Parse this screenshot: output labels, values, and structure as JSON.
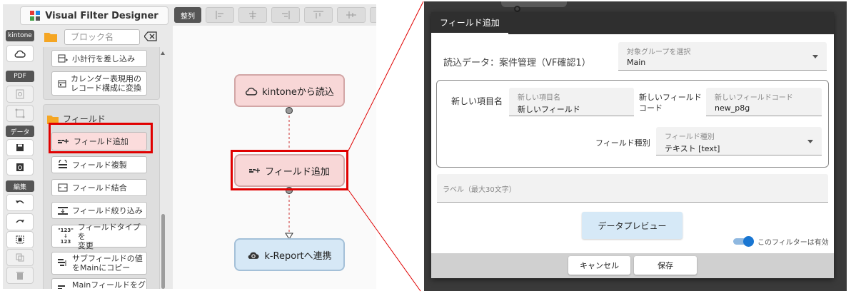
{
  "app": {
    "title": "Visual Filter Designer"
  },
  "toolbar": {
    "align_label": "整列"
  },
  "sidebar": {
    "kintone_label": "kintone",
    "pdf_label": "PDF",
    "data_label": "データ",
    "edit_label": "編集"
  },
  "palette": {
    "search_placeholder": "ブロック名",
    "items_top": [
      {
        "label": "小計行を差し込み",
        "icon": "table-row-insert-icon"
      },
      {
        "label": "カレンダー表現用の\nレコード構成に変換",
        "icon": "calendar-icon"
      }
    ],
    "field_folder": "フィールド",
    "field_items": [
      {
        "label": "フィールド追加",
        "icon": "field-add-icon"
      },
      {
        "label": "フィールド複製",
        "icon": "field-copy-icon"
      },
      {
        "label": "フィールド結合",
        "icon": "field-merge-icon"
      },
      {
        "label": "フィールド絞り込み",
        "icon": "field-filter-icon"
      },
      {
        "label": "フィールドタイプを\n変更",
        "icon": "field-type-icon"
      },
      {
        "label": "サブフィールドの値\nをMainにコピー",
        "icon": "subfield-copy-icon"
      },
      {
        "label": "Mainフィールドをグ\nループに変換",
        "icon": "group-convert-icon"
      }
    ],
    "type_icon_text_1": "\"123\"",
    "type_icon_text_2": "123"
  },
  "flow": {
    "node1": "kintoneから読込",
    "node2": "フィールド追加",
    "node3": "k-Reportへ連携"
  },
  "dialog": {
    "tab": "フィールド追加",
    "read_data": "読込データ：案件管理（VF確認1）",
    "target_group_label": "対象グループを選択",
    "target_group_value": "Main",
    "new_item_label": "新しい項目名",
    "new_item_field_label": "新しい項目名",
    "new_item_value": "新しいフィールド",
    "new_code_label": "新しいフィールド\nコード",
    "new_code_field_label": "新しいフィールドコード",
    "new_code_value": "new_p8g",
    "field_type_label": "フィールド種別",
    "field_type_field_label": "フィールド種別",
    "field_type_value": "テキスト [text]",
    "label_placeholder": "ラベル（最大30文字）",
    "preview_button": "データプレビュー",
    "toggle_label": "このフィルターは有効",
    "toggle_on": true,
    "cancel_button": "キャンセル",
    "save_button": "保存"
  },
  "colors": {
    "highlight_red": "#e00000",
    "node_pink": "#f8d7d7",
    "node_blue": "#d6e8f6",
    "dialog_header": "#2f2f2f",
    "toggle_blue": "#1976d2"
  }
}
